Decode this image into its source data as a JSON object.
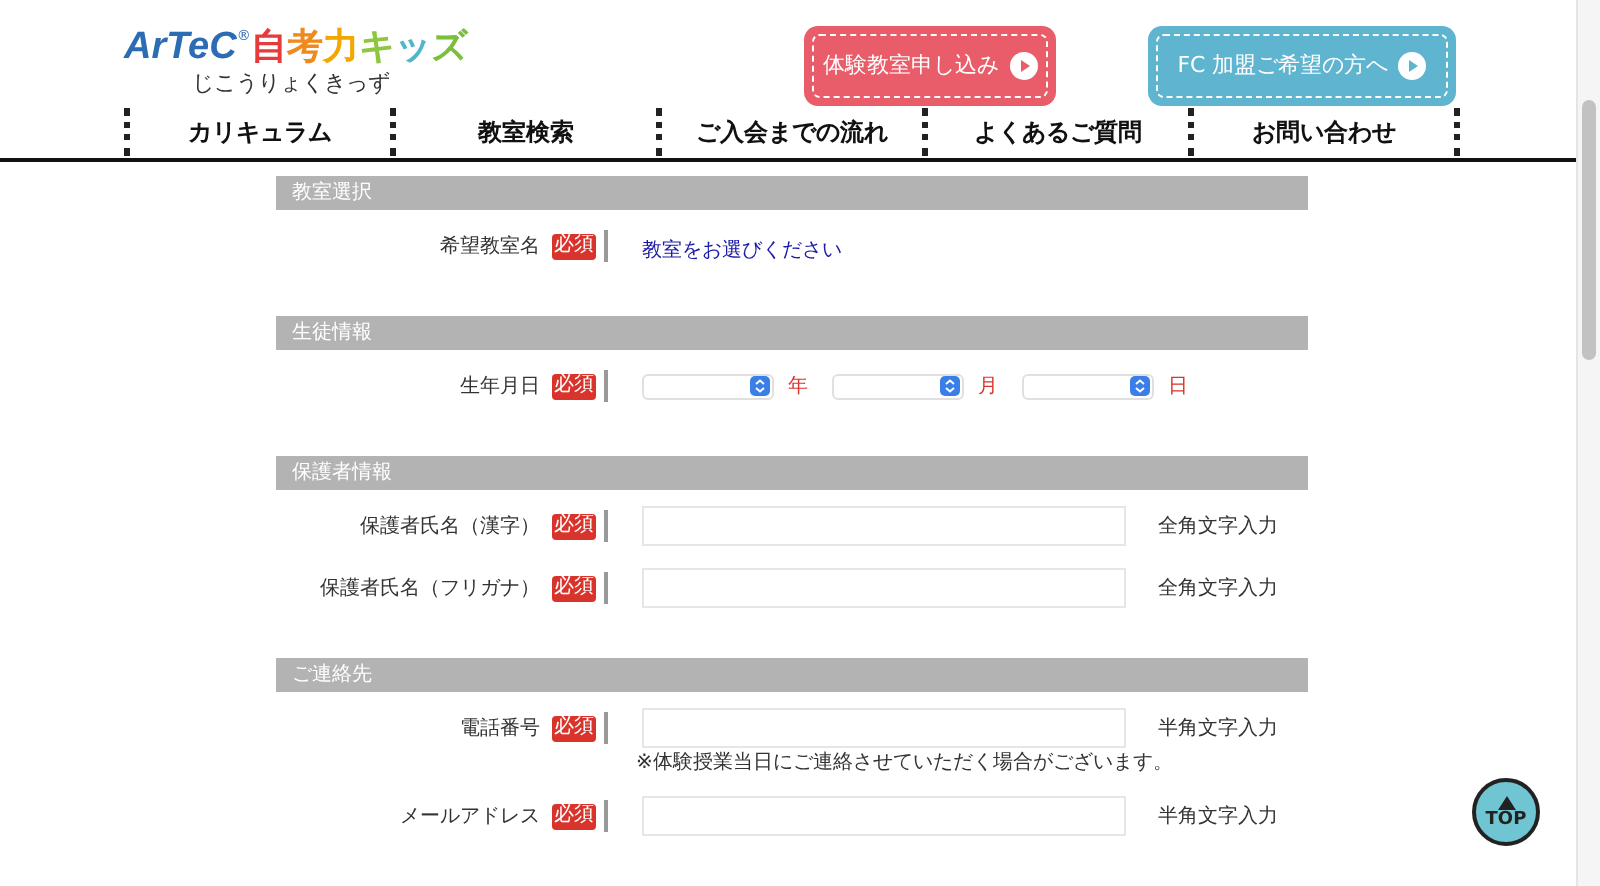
{
  "header": {
    "logo": {
      "brand": "ArTeC",
      "mark": "®",
      "title": "自考力キッズ",
      "reading": "じこうりょくきっず"
    },
    "buttons": [
      {
        "label": "体験教室申し込み",
        "color": "#e85d69"
      },
      {
        "label": "FC 加盟ご希望の方へ",
        "color": "#5fb4d0"
      }
    ]
  },
  "nav": [
    "カリキュラム",
    "教室検索",
    "ご入会までの流れ",
    "よくあるご質問",
    "お問い合わせ"
  ],
  "sections": [
    {
      "title": "教室選択",
      "rows": [
        {
          "kind": "link",
          "label": "希望教室名",
          "badge": "必須",
          "value": "教室をお選びください"
        }
      ]
    },
    {
      "title": "生徒情報",
      "rows": [
        {
          "kind": "date",
          "label": "生年月日",
          "badge": "必須",
          "units": [
            "年",
            "月",
            "日"
          ]
        }
      ]
    },
    {
      "title": "保護者情報",
      "rows": [
        {
          "kind": "text",
          "label": "保護者氏名（漢字）",
          "badge": "必須",
          "hint": "全角文字入力"
        },
        {
          "kind": "text",
          "label": "保護者氏名（フリガナ）",
          "badge": "必須",
          "hint": "全角文字入力"
        }
      ]
    },
    {
      "title": "ご連絡先",
      "rows": [
        {
          "kind": "text",
          "label": "電話番号",
          "badge": "必須",
          "hint": "半角文字入力",
          "note": "※体験授業当日にご連絡させていただく場合がございます。"
        },
        {
          "kind": "text",
          "label": "メールアドレス",
          "badge": "必須",
          "hint": "半角文字入力"
        }
      ]
    }
  ],
  "top_button": "TOP"
}
